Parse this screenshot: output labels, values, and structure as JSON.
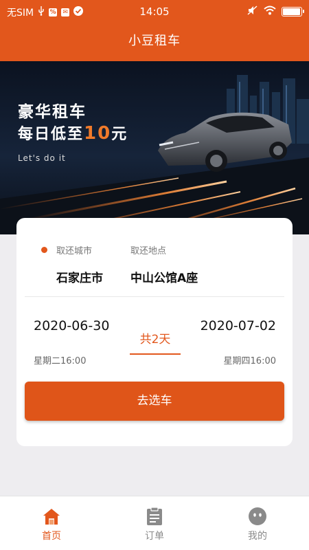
{
  "status_bar": {
    "carrier": "无SIM",
    "time": "14:05",
    "left_icons": [
      "usb-icon",
      "notification-icon",
      "check-icon"
    ],
    "right_icons": [
      "mute-icon",
      "wifi-icon",
      "battery-icon"
    ]
  },
  "header": {
    "title": "小豆租车"
  },
  "banner": {
    "title": "豪华租车",
    "subtitle_prefix": "每日低至",
    "subtitle_number": "10",
    "subtitle_suffix": "元",
    "tagline": "Let's do it"
  },
  "booking": {
    "city_label": "取还城市",
    "city_value": "石家庄市",
    "place_label": "取还地点",
    "place_value": "中山公馆A座",
    "pickup_date": "2020-06-30",
    "pickup_time": "星期二16:00",
    "total_days": "共2天",
    "return_date": "2020-07-02",
    "return_time": "星期四16:00",
    "button_label": "去选车"
  },
  "tabs": [
    {
      "label": "首页",
      "icon": "home-icon",
      "active": true
    },
    {
      "label": "订单",
      "icon": "order-icon",
      "active": false
    },
    {
      "label": "我的",
      "icon": "profile-icon",
      "active": false
    }
  ],
  "colors": {
    "accent": "#e2571c",
    "inactive": "#8a8a8a"
  }
}
